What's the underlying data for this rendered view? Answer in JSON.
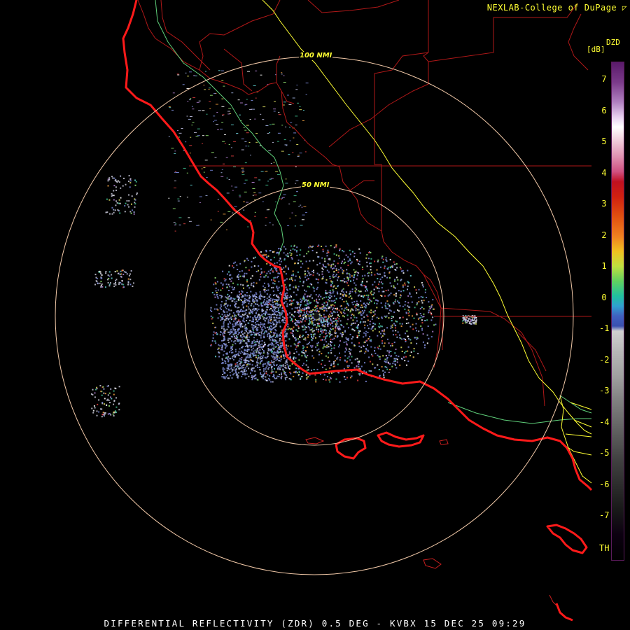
{
  "credit": "NEXLAB-College of DuPage",
  "product_footer": "DIFFERENTIAL REFLECTIVITY (ZDR) 0.5 DEG - KVBX 15 DEC 25 09:29",
  "range_rings": [
    {
      "label": "100 NMI",
      "distance_nmi": 100
    },
    {
      "label": "50 NMI",
      "distance_nmi": 50
    }
  ],
  "colorbar": {
    "title": "DZD",
    "unit": "[dB]",
    "ticks": [
      {
        "label": "7",
        "value": 7
      },
      {
        "label": "6",
        "value": 6
      },
      {
        "label": "5",
        "value": 5
      },
      {
        "label": "4",
        "value": 4
      },
      {
        "label": "3",
        "value": 3
      },
      {
        "label": "2",
        "value": 2
      },
      {
        "label": "1",
        "value": 1
      },
      {
        "label": "0",
        "value": 0
      },
      {
        "label": "-1",
        "value": -1
      },
      {
        "label": "-2",
        "value": -2
      },
      {
        "label": "-3",
        "value": -3
      },
      {
        "label": "-4",
        "value": -4
      },
      {
        "label": "-5",
        "value": -5
      },
      {
        "label": "-6",
        "value": -6
      },
      {
        "label": "-7",
        "value": -7
      },
      {
        "label": "TH",
        "value": -8
      }
    ]
  },
  "colors": {
    "coastline": "#ff1a1a",
    "county_lines": "#b01818",
    "highways": "#ffff33",
    "rivers": "#5fd07a",
    "range_rings": "#f2c9a8",
    "text": "#ffff33"
  }
}
